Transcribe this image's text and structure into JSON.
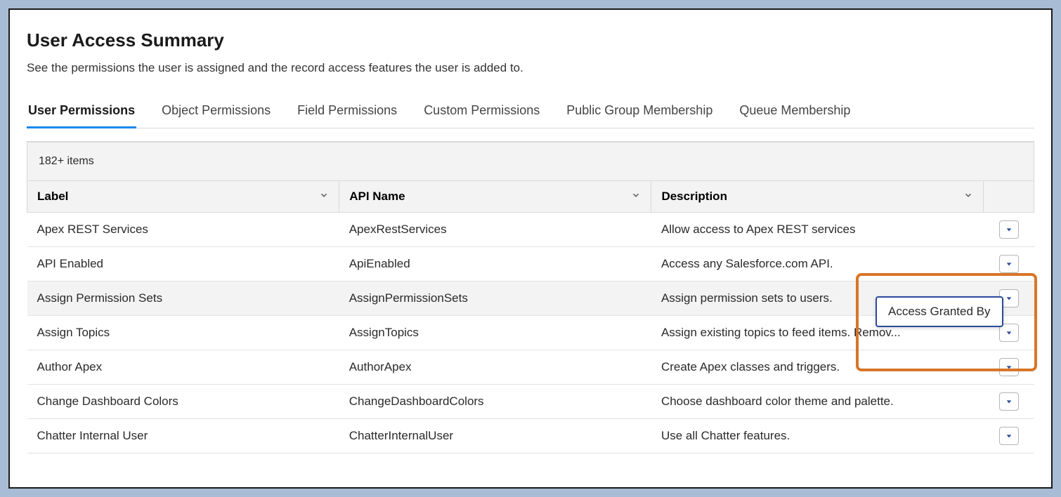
{
  "header": {
    "title": "User Access Summary",
    "subtitle": "See the permissions the user is assigned and the record access features the user is added to."
  },
  "tabs": [
    {
      "label": "User Permissions",
      "active": true
    },
    {
      "label": "Object Permissions",
      "active": false
    },
    {
      "label": "Field Permissions",
      "active": false
    },
    {
      "label": "Custom Permissions",
      "active": false
    },
    {
      "label": "Public Group Membership",
      "active": false
    },
    {
      "label": "Queue Membership",
      "active": false
    }
  ],
  "table": {
    "count_text": "182+ items",
    "columns": [
      {
        "label": "Label"
      },
      {
        "label": "API Name"
      },
      {
        "label": "Description"
      }
    ],
    "rows": [
      {
        "label": "Apex REST Services",
        "api": "ApexRestServices",
        "desc": "Allow access to Apex REST services"
      },
      {
        "label": "API Enabled",
        "api": "ApiEnabled",
        "desc": "Access any Salesforce.com API."
      },
      {
        "label": "Assign Permission Sets",
        "api": "AssignPermissionSets",
        "desc": "Assign permission sets to users.",
        "highlight": true
      },
      {
        "label": "Assign Topics",
        "api": "AssignTopics",
        "desc": "Assign existing topics to feed items. Remov..."
      },
      {
        "label": "Author Apex",
        "api": "AuthorApex",
        "desc": "Create Apex classes and triggers."
      },
      {
        "label": "Change Dashboard Colors",
        "api": "ChangeDashboardColors",
        "desc": "Choose dashboard color theme and palette."
      },
      {
        "label": "Chatter Internal User",
        "api": "ChatterInternalUser",
        "desc": "Use all Chatter features."
      }
    ]
  },
  "dropdown": {
    "item": "Access Granted By"
  },
  "colors": {
    "accent": "#1589ee",
    "highlight_border": "#d97528",
    "dropdown_border": "#2a4a9a"
  }
}
